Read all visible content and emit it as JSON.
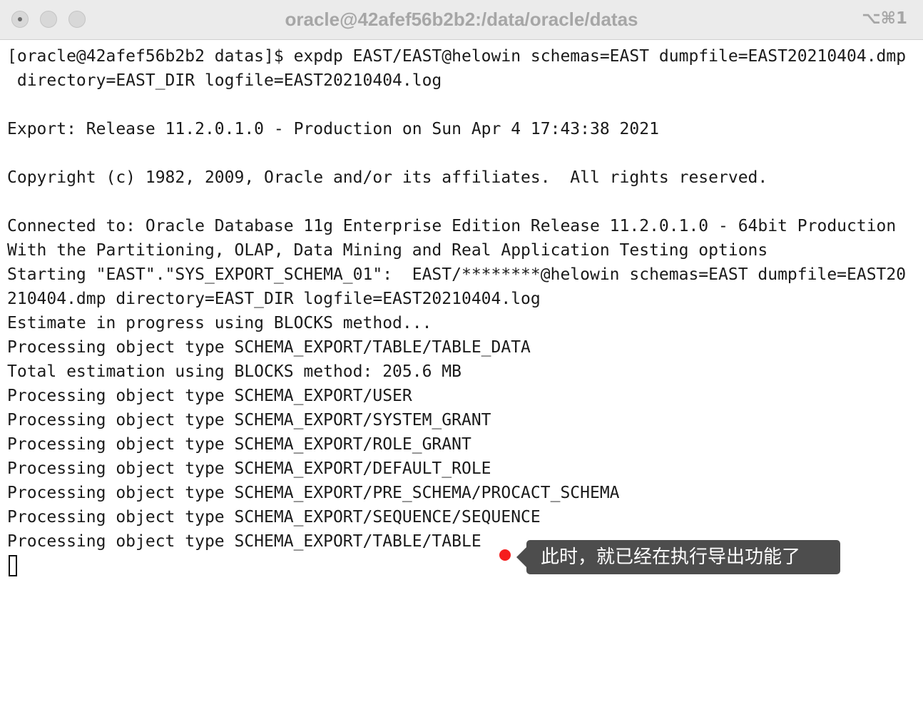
{
  "window": {
    "title": "oracle@42afef56b2b2:/data/oracle/datas",
    "shortcut": "⌥⌘1"
  },
  "terminal": {
    "lines": [
      "[oracle@42afef56b2b2 datas]$ expdp EAST/EAST@helowin schemas=EAST dumpfile=EAST20210404.dmp",
      " directory=EAST_DIR logfile=EAST20210404.log",
      "",
      "Export: Release 11.2.0.1.0 - Production on Sun Apr 4 17:43:38 2021",
      "",
      "Copyright (c) 1982, 2009, Oracle and/or its affiliates.  All rights reserved.",
      "",
      "Connected to: Oracle Database 11g Enterprise Edition Release 11.2.0.1.0 - 64bit Production",
      "With the Partitioning, OLAP, Data Mining and Real Application Testing options",
      "Starting \"EAST\".\"SYS_EXPORT_SCHEMA_01\":  EAST/********@helowin schemas=EAST dumpfile=EAST20",
      "210404.dmp directory=EAST_DIR logfile=EAST20210404.log",
      "Estimate in progress using BLOCKS method...",
      "Processing object type SCHEMA_EXPORT/TABLE/TABLE_DATA",
      "Total estimation using BLOCKS method: 205.6 MB",
      "Processing object type SCHEMA_EXPORT/USER",
      "Processing object type SCHEMA_EXPORT/SYSTEM_GRANT",
      "Processing object type SCHEMA_EXPORT/ROLE_GRANT",
      "Processing object type SCHEMA_EXPORT/DEFAULT_ROLE",
      "Processing object type SCHEMA_EXPORT/PRE_SCHEMA/PROCACT_SCHEMA",
      "Processing object type SCHEMA_EXPORT/SEQUENCE/SEQUENCE",
      "Processing object type SCHEMA_EXPORT/TABLE/TABLE"
    ]
  },
  "annotation": {
    "text": "此时，就已经在执行导出功能了",
    "dot_color": "#f51d1d",
    "bubble_color": "#4d4d4d"
  }
}
